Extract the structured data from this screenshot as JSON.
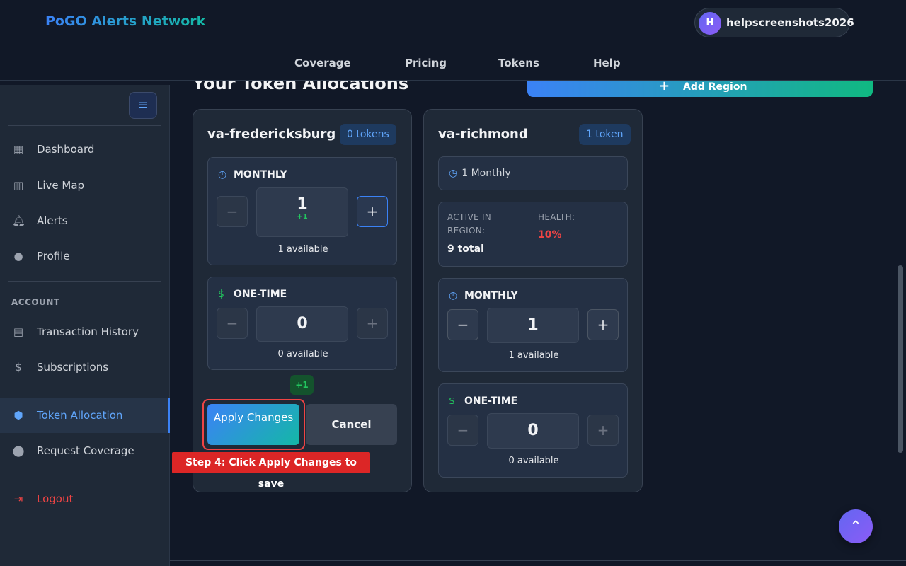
{
  "header": {
    "brand": "PoGO Alerts Network",
    "user_initial": "H",
    "username": "helpscreenshots2026"
  },
  "nav": {
    "coverage": "Coverage",
    "pricing": "Pricing",
    "tokens": "Tokens",
    "help": "Help"
  },
  "sidebar": {
    "items": [
      "Dashboard",
      "Live Map",
      "Alerts",
      "Profile"
    ],
    "section_label": "ACCOUNT",
    "account_items": [
      "Transaction History",
      "Subscriptions",
      "Token Allocation",
      "Request Coverage"
    ],
    "logout": "Logout"
  },
  "main": {
    "title": "Your Token Allocations",
    "add_region": "Add Region"
  },
  "cards": [
    {
      "region": "va-fredericksburg",
      "badge": "0 tokens",
      "monthly": {
        "label": "MONTHLY",
        "value": "1",
        "delta": "+1",
        "available": "1 available"
      },
      "one_time": {
        "label": "ONE-TIME",
        "value": "0",
        "available": "0 available"
      },
      "pending_delta": "+1",
      "apply_label": "Apply Changes",
      "cancel_label": "Cancel",
      "tip": "Step 4: Click Apply Changes to save"
    },
    {
      "region": "va-richmond",
      "badge": "1 token",
      "current_plan": "1 Monthly",
      "active_label": "ACTIVE IN REGION:",
      "active_value": "9 total",
      "health_label": "HEALTH:",
      "health_value": "10%",
      "monthly": {
        "label": "MONTHLY",
        "value": "1",
        "available": "1 available"
      },
      "one_time": {
        "label": "ONE-TIME",
        "value": "0",
        "available": "0 available"
      }
    }
  ],
  "colors": {
    "accent": "#3b82f6",
    "success": "#22c55e",
    "danger": "#ef4444",
    "background": "#111827",
    "card": "#1f2937"
  }
}
